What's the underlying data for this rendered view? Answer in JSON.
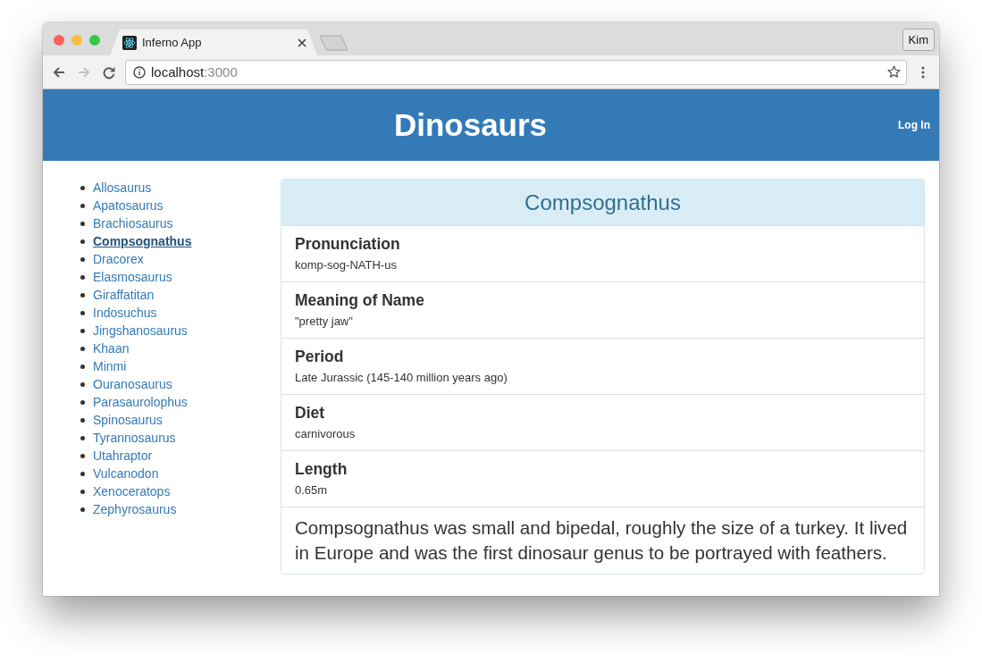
{
  "browser": {
    "tabs": [
      {
        "title": "Inferno App",
        "selected": true
      }
    ],
    "profile": "Kim",
    "nav_buttons": [
      {
        "kind": "back",
        "disabled": false
      },
      {
        "kind": "forward",
        "disabled": true
      },
      {
        "kind": "reload",
        "disabled": false
      }
    ],
    "address": {
      "host": "localhost",
      "port": ":3000"
    }
  },
  "header": {
    "title": "Dinosaurs",
    "login": "Log In"
  },
  "sidebar": {
    "items": [
      {
        "label": "Allosaurus",
        "selected": false
      },
      {
        "label": "Apatosaurus",
        "selected": false
      },
      {
        "label": "Brachiosaurus",
        "selected": false
      },
      {
        "label": "Compsognathus",
        "selected": true
      },
      {
        "label": "Dracorex",
        "selected": false
      },
      {
        "label": "Elasmosaurus",
        "selected": false
      },
      {
        "label": "Giraffatitan",
        "selected": false
      },
      {
        "label": "Indosuchus",
        "selected": false
      },
      {
        "label": "Jingshanosaurus",
        "selected": false
      },
      {
        "label": "Khaan",
        "selected": false
      },
      {
        "label": "Minmi",
        "selected": false
      },
      {
        "label": "Ouranosaurus",
        "selected": false
      },
      {
        "label": "Parasaurolophus",
        "selected": false
      },
      {
        "label": "Spinosaurus",
        "selected": false
      },
      {
        "label": "Tyrannosaurus",
        "selected": false
      },
      {
        "label": "Utahraptor",
        "selected": false
      },
      {
        "label": "Vulcanodon",
        "selected": false
      },
      {
        "label": "Xenoceratops",
        "selected": false
      },
      {
        "label": "Zephyrosaurus",
        "selected": false
      }
    ]
  },
  "detail": {
    "title": "Compsognathus",
    "fields": [
      {
        "label": "Pronunciation",
        "value": "komp-sog-NATH-us"
      },
      {
        "label": "Meaning of Name",
        "value": "\"pretty jaw\""
      },
      {
        "label": "Period",
        "value": "Late Jurassic (145-140 million years ago)"
      },
      {
        "label": "Diet",
        "value": "carnivorous"
      },
      {
        "label": "Length",
        "value": "0.65m"
      }
    ],
    "description": "Compsognathus was small and bipedal, roughly the size of a turkey. It lived in Europe and was the first dinosaur genus to be portrayed with feathers."
  }
}
